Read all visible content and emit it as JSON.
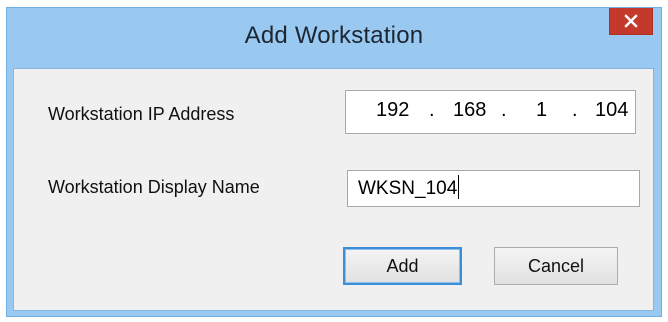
{
  "window": {
    "title": "Add Workstation",
    "close_icon": "close-icon"
  },
  "form": {
    "ip_label": "Workstation IP Address",
    "ip_octets": [
      "192",
      "168",
      "1",
      "104"
    ],
    "ip_separator": ".",
    "name_label": "Workstation Display Name",
    "name_value": "WKSN_104"
  },
  "buttons": {
    "add_label": "Add",
    "cancel_label": "Cancel"
  },
  "colors": {
    "titlebar": "#99c9f0",
    "close_button": "#c5392d",
    "client_area": "#f0f0f0",
    "default_button_border": "#3c8fd6"
  }
}
